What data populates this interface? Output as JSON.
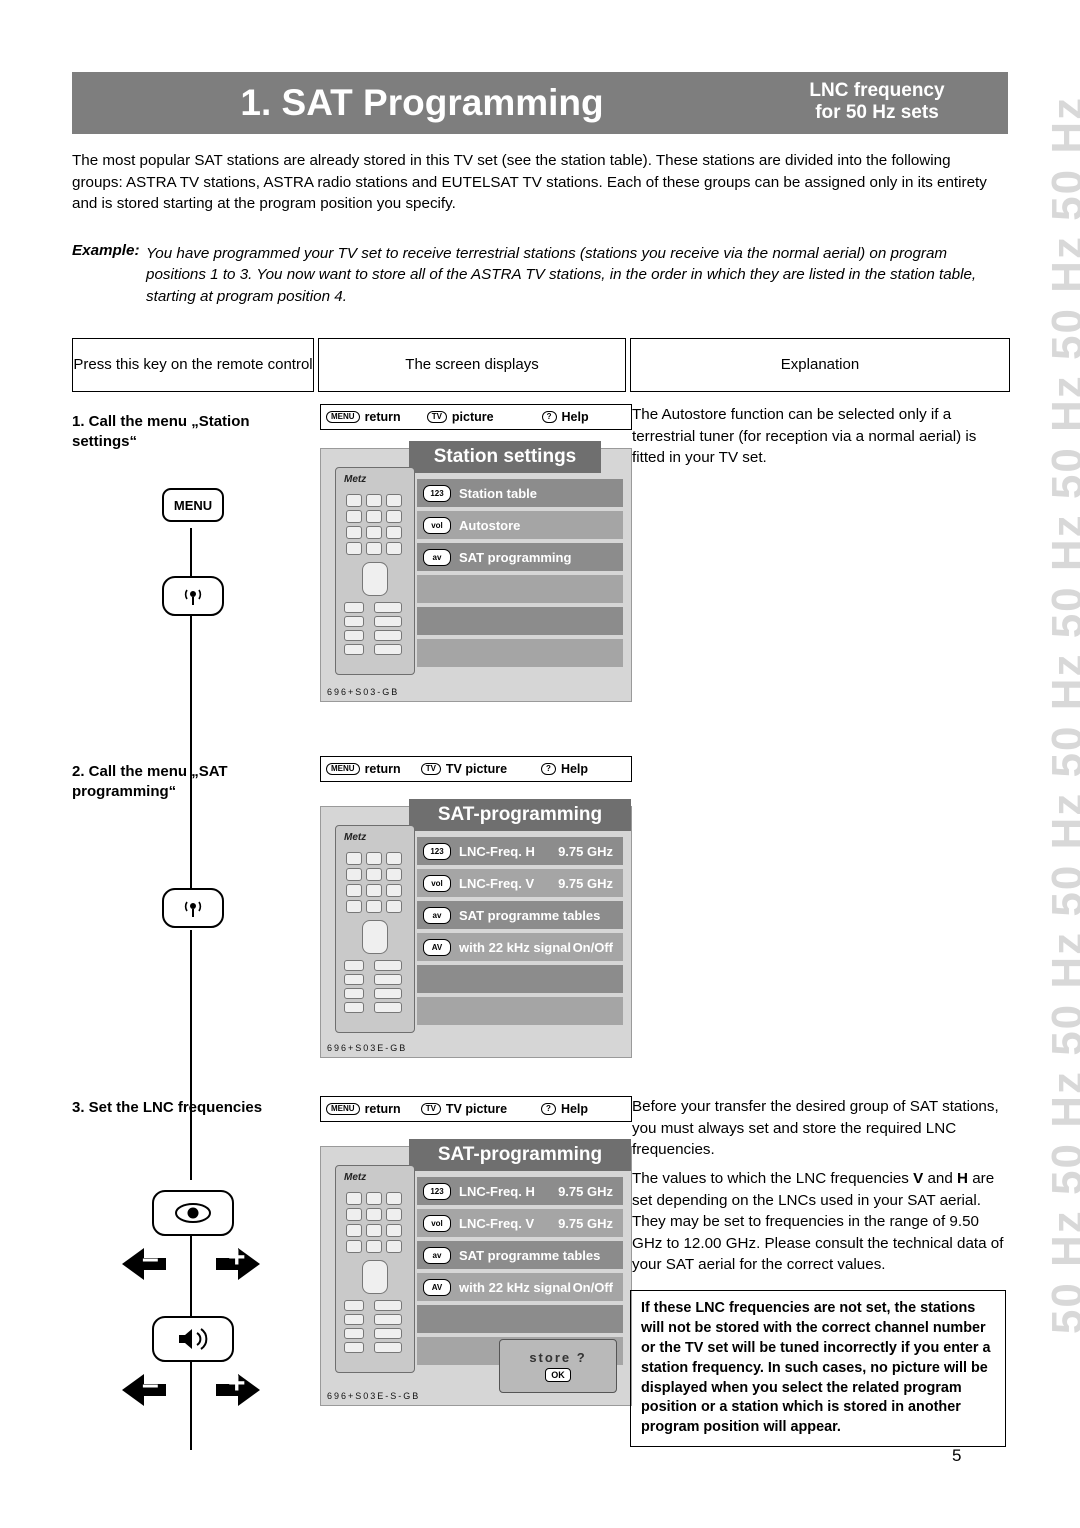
{
  "header": {
    "title": "1. SAT Programming",
    "sub_line1": "LNC frequency",
    "sub_line2": "for 50 Hz sets"
  },
  "side_band": {
    "text": "50 Hz 50 Hz 50 Hz 50 Hz 50 Hz 50 Hz 50 Hz 50 Hz 50 Hz"
  },
  "intro": "The most popular SAT stations are already stored in this TV set (see the station table). These stations are divided into the following groups: ASTRA TV stations, ASTRA radio stations and EUTELSAT TV stations. Each of these groups can be assigned only in its entirety and is stored starting at the program position you specify.",
  "example": {
    "label": "Example:",
    "body": "You have programmed your TV set to receive terrestrial stations (stations you receive via the normal aerial) on program positions 1 to 3. You now want to store all of the ASTRA TV stations, in the order in which they are listed in the station table, starting at program position 4."
  },
  "columns": {
    "col1": "Press this key on the remote control",
    "col2": "The screen displays",
    "col3": "Explanation"
  },
  "steps": {
    "step1": "1. Call the menu „Station settings“",
    "step2": "2. Call the menu „SAT programming“",
    "step3": "3. Set the LNC frequencies"
  },
  "keys": {
    "menu_label": "MENU",
    "sat_icon": "satellite-dish-icon",
    "eye_icon": "eye-icon",
    "sound_icon": "sound-icon",
    "minus": "–",
    "plus": "+"
  },
  "osd": {
    "bar1": {
      "return": "return",
      "picture": "picture",
      "help": "Help",
      "menu_pill": "MENU",
      "tv_pill": "TV",
      "help_pill": "?"
    },
    "bar2": {
      "return": "return",
      "picture": "TV picture",
      "help": "Help",
      "menu_pill": "MENU",
      "tv_pill": "TV",
      "help_pill": "?"
    },
    "bar3": {
      "return": "return",
      "picture": "TV picture",
      "help": "Help",
      "menu_pill": "MENU",
      "tv_pill": "TV",
      "help_pill": "?"
    }
  },
  "screen1": {
    "title": "Station settings",
    "code": "696+S03-GB",
    "rows": [
      {
        "icon": "123",
        "label": "Station table",
        "value": ""
      },
      {
        "icon": "vol",
        "label": "Autostore",
        "value": ""
      },
      {
        "icon": "av",
        "label": "SAT programming",
        "value": ""
      }
    ]
  },
  "screen2": {
    "title": "SAT-programming",
    "code": "696+S03E-GB",
    "rows": [
      {
        "icon": "123",
        "label": "LNC-Freq. H",
        "value": "9.75 GHz"
      },
      {
        "icon": "vol",
        "label": "LNC-Freq. V",
        "value": "9.75 GHz"
      },
      {
        "icon": "av",
        "label": "SAT programme tables",
        "value": ""
      },
      {
        "icon": "AV",
        "label": "with 22 kHz signal",
        "value": "On/Off"
      }
    ]
  },
  "screen3": {
    "title": "SAT-programming",
    "code": "696+S03E-S-GB",
    "rows": [
      {
        "icon": "123",
        "label": "LNC-Freq. H",
        "value": "9.75 GHz"
      },
      {
        "icon": "vol",
        "label": "LNC-Freq. V",
        "value": "9.75 GHz"
      },
      {
        "icon": "av",
        "label": "SAT programme tables",
        "value": ""
      },
      {
        "icon": "AV",
        "label": "with 22 kHz signal",
        "value": "On/Off"
      }
    ],
    "store_label": "store ?",
    "store_ok": "OK"
  },
  "explanations": {
    "e1": "The Autostore function can be selected only if a terrestrial tuner (for reception via a normal aerial) is fitted in your TV set.",
    "e3a": "Before your transfer the desired group of SAT stations, you must always set and store the required LNC frequencies.",
    "e3b_pre": "The values to which the LNC frequencies ",
    "e3b_v": "V",
    "e3b_mid": " and ",
    "e3b_h": "H",
    "e3b_post": " are set depending on the LNCs used in your SAT aerial. They may be set to frequencies in the range of 9.50 GHz to 12.00 GHz. Please consult the technical data of your SAT aerial for the correct values.",
    "warning": "If these LNC frequencies are not set, the stations will not be stored with the correct channel number or the TV set will be tuned incorrectly if you enter a station frequency. In such cases, no picture will be displayed when you select the related program position or a station which is stored in another program position will appear."
  },
  "page_number": "5"
}
